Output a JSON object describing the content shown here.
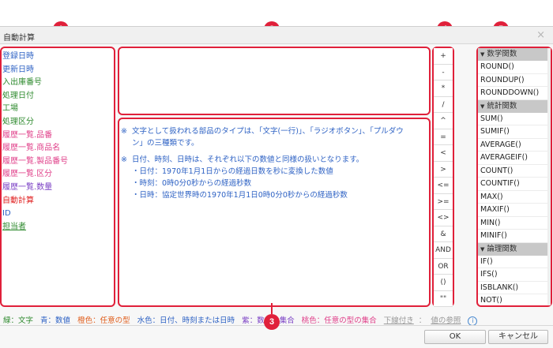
{
  "dialog": {
    "title": "自動計算",
    "close_glyph": "×"
  },
  "badges": [
    "1",
    "2",
    "3",
    "4",
    "5"
  ],
  "fields": [
    {
      "label": "登録日時",
      "color": "blue"
    },
    {
      "label": "更新日時",
      "color": "blue"
    },
    {
      "label": "入出庫番号",
      "color": "green"
    },
    {
      "label": "処理日付",
      "color": "green"
    },
    {
      "label": "工場",
      "color": "green"
    },
    {
      "label": "処理区分",
      "color": "green"
    },
    {
      "label": "履歴一覧.品番",
      "color": "pink"
    },
    {
      "label": "履歴一覧.商品名",
      "color": "pink"
    },
    {
      "label": "履歴一覧.製品番号",
      "color": "pink"
    },
    {
      "label": "履歴一覧.区分",
      "color": "pink"
    },
    {
      "label": "履歴一覧.数量",
      "color": "purple"
    },
    {
      "label": "自動計算",
      "color": "red"
    },
    {
      "label": "ID",
      "color": "blue"
    },
    {
      "label": "担当者",
      "color": "ul"
    }
  ],
  "formula": {
    "value": ""
  },
  "notes": {
    "mark": "※",
    "p1_line1": "文字として扱われる部品のタイプは、「文字(一行)」、「ラジオボタン」、「プルダウ",
    "p1_line2": "ン」の三種類です。",
    "p2_line1": "日付、時刻、日時は、それぞれ以下の数値と同様の扱いとなります。",
    "p2_items": [
      "・日付：1970年1月1日からの経過日数を秒に変換した数値",
      "・時刻：0時0分0秒からの経過秒数",
      "・日時：協定世界時の1970年1月1日0時0分0秒からの経過秒数"
    ]
  },
  "operators": [
    "+",
    "-",
    "*",
    "/",
    "^",
    "=",
    "<",
    ">",
    "<=",
    ">=",
    "<>",
    "&",
    "AND",
    "OR",
    "()",
    "\"\""
  ],
  "functions": {
    "categories": [
      {
        "name": "数学関数",
        "items": [
          "ROUND()",
          "ROUNDUP()",
          "ROUNDDOWN()"
        ]
      },
      {
        "name": "統計関数",
        "items": [
          "SUM()",
          "SUMIF()",
          "AVERAGE()",
          "AVERAGEIF()",
          "COUNT()",
          "COUNTIF()",
          "MAX()",
          "MAXIF()",
          "MIN()",
          "MINIF()"
        ]
      },
      {
        "name": "論理関数",
        "items": [
          "IF()",
          "IFS()",
          "ISBLANK()",
          "NOT()"
        ]
      }
    ]
  },
  "legend": {
    "green": "緑：文字",
    "blue": "青：数値",
    "orange": "橙色：任意の型",
    "water": "水色：日付、時刻または日時",
    "purple": "紫：数値の集合",
    "pink": "桃色：任意の型の集合",
    "underline": "下線付き",
    "separator": "：",
    "ref": "値の参照",
    "info_glyph": "i"
  },
  "buttons": {
    "ok": "OK",
    "cancel": "キャンセル"
  },
  "colors": {
    "accent": "#e0203a",
    "field_blue": "#2e62c4",
    "field_green": "#2e8a2e",
    "field_pink": "#e0408a",
    "field_purple": "#7a3fc4",
    "field_red": "#e02020"
  }
}
